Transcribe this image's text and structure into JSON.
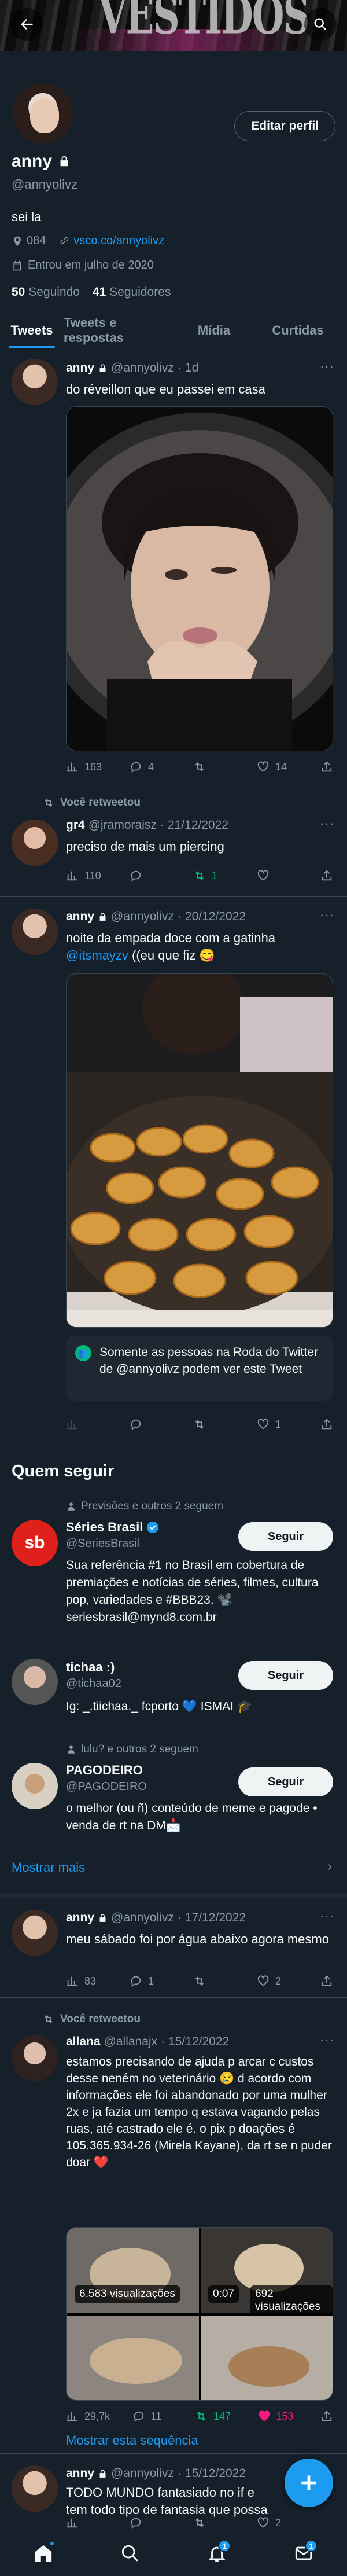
{
  "header": {
    "back_icon": "arrow-left-icon",
    "search_icon": "search-icon"
  },
  "profile": {
    "name": "anny",
    "handle": "@annyolivz",
    "bio": "sei la",
    "location": "084",
    "website": "vsco.co/annyolivz",
    "joined": "Entrou em julho de 2020",
    "following_count": "50",
    "following_label": "Seguindo",
    "followers_count": "41",
    "followers_label": "Seguidores",
    "edit_label": "Editar perfil"
  },
  "tabs": [
    "Tweets",
    "Tweets e respostas",
    "Mídia",
    "Curtidas"
  ],
  "tweets": [
    {
      "name": "anny",
      "handle": "@annyolivz",
      "time": "1d",
      "text": "do réveillon que eu passei em casa",
      "replies_label": "",
      "stats": {
        "views": "163",
        "replies": "4",
        "retweets": "",
        "likes": "14"
      }
    },
    {
      "retweet_label": "Você retweetou",
      "name": "gr4",
      "handle": "@jramoraisz",
      "time": "21/12/2022",
      "text": "preciso de mais um piercing",
      "stats": {
        "views": "110",
        "replies": "",
        "retweets": "1",
        "likes": ""
      }
    },
    {
      "name": "anny",
      "handle": "@annyolivz",
      "time": "20/12/2022",
      "text_a": "noite da empada doce com a gatinha",
      "mention": "@itsmayzv",
      "text_b": "((eu que fiz 😋",
      "notice": "Somente as pessoas na Roda do Twitter de @annyolivz podem ver este Tweet",
      "stats": {
        "views": "",
        "replies": "",
        "retweets": "",
        "likes": "1"
      }
    }
  ],
  "who_to_follow": {
    "title": "Quem seguir",
    "show_more": "Mostrar mais",
    "follow_label": "Seguir",
    "accounts": [
      {
        "context": "Previsões e outros 2 seguem",
        "name": "Séries Brasil",
        "handle": "@SeriesBrasil",
        "bio": "Sua referência #1 no Brasil em cobertura de premiações e notícias de séries, filmes, cultura pop, variedades e #BBB23. 📽️ seriesbrasil@mynd8.com.br"
      },
      {
        "context": "",
        "name": "tichaa :)",
        "handle": "@tichaa02",
        "bio": "Ig: _.tiichaa._ fcporto 💙 ISMAI 🎓"
      },
      {
        "context": "lulu? e outros 2 seguem",
        "name": "PAGODEIRO",
        "handle": "@PAGODEIRO",
        "bio": "o melhor (ou ñ) conteúdo de meme e pagode • venda de rt na DM📩"
      }
    ]
  },
  "tweets2": [
    {
      "name": "anny",
      "handle": "@annyolivz",
      "time": "17/12/2022",
      "text": "meu sábado foi por água abaixo agora mesmo",
      "stats": {
        "views": "83",
        "replies": "1",
        "retweets": "",
        "likes": "2"
      }
    },
    {
      "retweet_label": "Você retweetou",
      "name": "allana",
      "handle": "@allanajx",
      "time": "15/12/2022",
      "text": "estamos precisando de ajuda p arcar c custos desse neném no veterinário 😢 d acordo com informações ele foi abandonado por uma mulher 2x e ja fazia um tempo q estava vagando pelas ruas, até castrado ele é. o pix p doações é 105.365.934-26 (Mirela Kayane), da rt se n puder doar ❤️",
      "media_views_1": "6.583 visualizações",
      "media_time": "0:07",
      "media_views_2": "692 visualizações",
      "thread_link": "Mostrar esta sequência",
      "stats": {
        "views": "29,7k",
        "replies": "11",
        "retweets": "147",
        "likes": "153"
      }
    },
    {
      "name": "anny",
      "handle": "@annyolivz",
      "time": "15/12/2022",
      "text": "TODO MUNDO fantasiado no if e tem todo tipo de fantasia que possa im",
      "stats": {
        "views": "",
        "replies": "",
        "retweets": "",
        "likes": "2"
      }
    }
  ],
  "bottom_nav": {
    "notifications_badge": "1",
    "messages_badge": "1"
  },
  "colors": {
    "background": "#15202b",
    "accent": "#1d9bf0",
    "retweet": "#00ba7c",
    "like": "#f91880"
  }
}
